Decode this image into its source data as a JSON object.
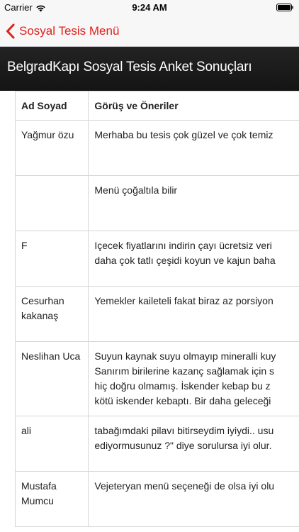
{
  "status_bar": {
    "carrier": "Carrier",
    "time": "9:24 AM",
    "wifi_icon": "wifi-icon",
    "battery_icon": "battery-icon"
  },
  "nav": {
    "back_label": "Sosyal Tesis Menü",
    "back_icon": "chevron-left-icon",
    "accent_color": "#e0201b"
  },
  "header": {
    "title": "BelgradKapı Sosyal Tesis Anket Sonuçları",
    "background": "#1b1b1b"
  },
  "table": {
    "headers": {
      "name": "Ad Soyad",
      "comment": "Görüş ve Öneriler"
    },
    "rows": [
      {
        "name": "Yağmur özu",
        "comment_lines": [
          "Merhaba bu tesis çok güzel ve çok temiz"
        ]
      },
      {
        "name": "",
        "comment_lines": [
          "Menü çoğaltıla bilir"
        ]
      },
      {
        "name": "F",
        "comment_lines": [
          "Içecek fiyatlarını indirin çayı ücretsiz veri",
          "daha çok tatlı çeşidi koyun ve kajun baha"
        ]
      },
      {
        "name": "Cesurhan kakanaş",
        "comment_lines": [
          "Yemekler kaileteli fakat biraz az porsiyon"
        ]
      },
      {
        "name": "Neslihan Uca",
        "comment_lines": [
          "Suyun kaynak suyu olmayıp mineralli kuy",
          "Sanırım birilerine kazanç sağlamak için s",
          "hiç doğru olmamış. İskender kebap bu z",
          "kötü iskender kebaptı. Bir daha geleceği"
        ]
      },
      {
        "name": "ali",
        "comment_lines": [
          "tabağımdaki pilavı bitirseydim iyiydi.. usu",
          "ediyormusunuz ?\" diye sorulursa iyi olur."
        ]
      },
      {
        "name": "Mustafa Mumcu",
        "comment_lines": [
          "Vejeteryan menü seçeneği de olsa iyi olu"
        ]
      }
    ]
  }
}
